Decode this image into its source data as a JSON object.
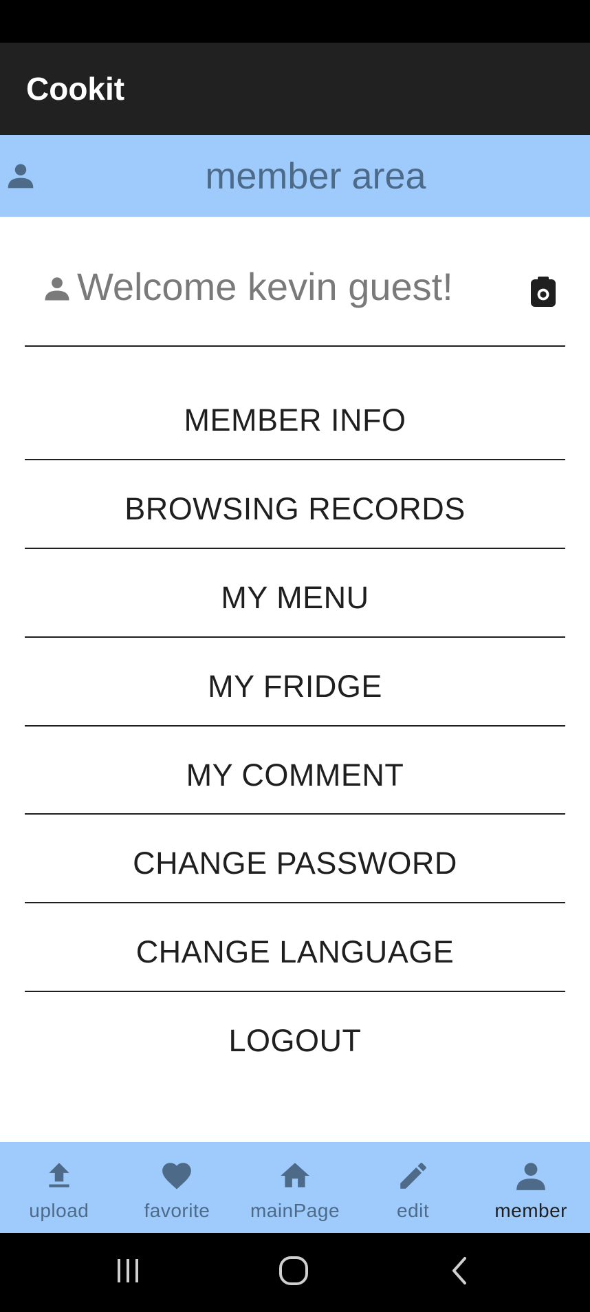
{
  "app": {
    "title": "Cookit"
  },
  "header": {
    "title": "member area",
    "icon": "person-icon"
  },
  "welcome": {
    "text": "Welcome kevin guest!",
    "icon": "person-icon",
    "action_icon": "camera-icon"
  },
  "menu": {
    "items": [
      {
        "label": "MEMBER INFO"
      },
      {
        "label": "BROWSING RECORDS"
      },
      {
        "label": "MY MENU"
      },
      {
        "label": "MY FRIDGE"
      },
      {
        "label": "MY COMMENT"
      },
      {
        "label": "CHANGE PASSWORD"
      },
      {
        "label": "CHANGE LANGUAGE"
      },
      {
        "label": "LOGOUT"
      }
    ]
  },
  "bottom_nav": {
    "items": [
      {
        "label": "upload",
        "icon": "upload-icon"
      },
      {
        "label": "favorite",
        "icon": "heart-icon"
      },
      {
        "label": "mainPage",
        "icon": "home-icon"
      },
      {
        "label": "edit",
        "icon": "pencil-icon"
      },
      {
        "label": "member",
        "icon": "person-icon"
      }
    ],
    "active": "member"
  },
  "system_nav": {
    "icons": [
      "recent-apps-icon",
      "home-circle-icon",
      "back-icon"
    ]
  },
  "colors": {
    "app_bar": "#212121",
    "accent_bar": "#9ecbfb",
    "accent_text": "#4d6b89",
    "text_dark": "#1f1f1f",
    "text_muted": "#7a7a7a"
  }
}
